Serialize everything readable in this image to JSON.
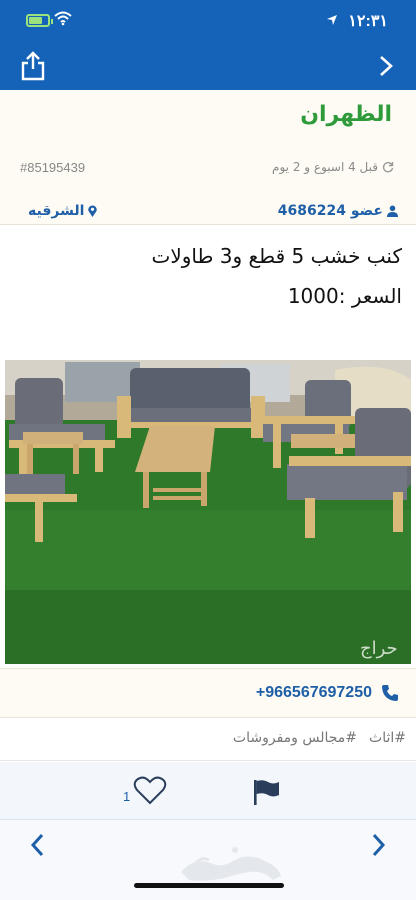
{
  "status_bar": {
    "time": "١٢:٣١",
    "icons": [
      "battery-charging-icon",
      "wifi-icon",
      "location-arrow-icon"
    ]
  },
  "nav": {
    "share_icon": "share-icon",
    "next_icon": "chevron-right-icon"
  },
  "header": {
    "city": "الظهران",
    "post_id": "#85195439",
    "posted": "قبل 4 اسبوع و 2 يوم",
    "member": "عضو 4686224",
    "region": "الشرقيه"
  },
  "listing": {
    "title": "كنب خشب 5 قطع و3 طاولات",
    "price": "السعر :1000"
  },
  "contact": {
    "phone": "+966567697250"
  },
  "tags": [
    "#اثاث",
    "#مجالس ومفروشات"
  ],
  "actions": {
    "like_count": "1"
  },
  "bottom": {
    "watermark": "حراج"
  },
  "colors": {
    "brand_blue": "#1463b8",
    "link_blue": "#1e5fa8",
    "city_green": "#2e9a3a"
  }
}
